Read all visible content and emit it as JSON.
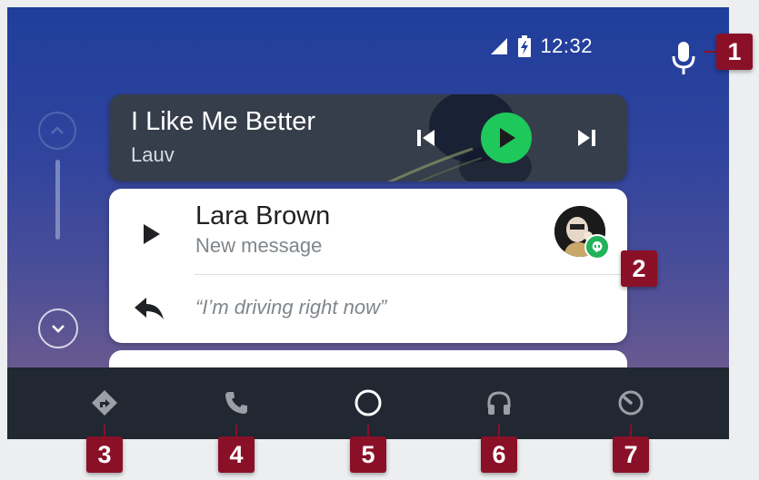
{
  "status_bar": {
    "time": "12:32"
  },
  "now_playing": {
    "title": "I Like Me Better",
    "artist": "Lauv"
  },
  "message": {
    "sender": "Lara Brown",
    "subtitle": "New message",
    "quick_reply": "“I’m driving right now”"
  },
  "nav": {
    "items": [
      {
        "icon": "navigation-icon"
      },
      {
        "icon": "phone-icon"
      },
      {
        "icon": "home-circle-icon"
      },
      {
        "icon": "headphones-icon"
      },
      {
        "icon": "exit-icon"
      }
    ]
  },
  "callouts": [
    "1",
    "2",
    "3",
    "4",
    "5",
    "6",
    "7"
  ],
  "colors": {
    "accent": "#1ec85a",
    "callout": "#8a1028",
    "navbar": "#212832",
    "card_dark": "#353e4a"
  }
}
